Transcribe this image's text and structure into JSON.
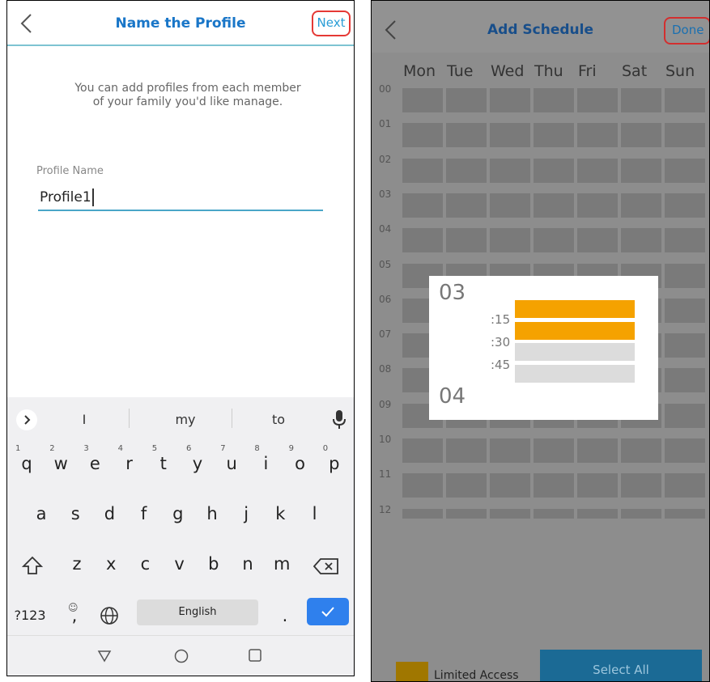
{
  "left": {
    "header": {
      "title": "Name the Profile",
      "next_label": "Next"
    },
    "description": "You can add profiles from each member of your family you'd like manage.",
    "field": {
      "label": "Profile Name",
      "value": "Profile1"
    },
    "keyboard": {
      "suggestions": [
        "I",
        "my",
        "to"
      ],
      "row1": [
        {
          "k": "q",
          "n": "1"
        },
        {
          "k": "w",
          "n": "2"
        },
        {
          "k": "e",
          "n": "3"
        },
        {
          "k": "r",
          "n": "4"
        },
        {
          "k": "t",
          "n": "5"
        },
        {
          "k": "y",
          "n": "6"
        },
        {
          "k": "u",
          "n": "7"
        },
        {
          "k": "i",
          "n": "8"
        },
        {
          "k": "o",
          "n": "9"
        },
        {
          "k": "p",
          "n": "0"
        }
      ],
      "row2": [
        "a",
        "s",
        "d",
        "f",
        "g",
        "h",
        "j",
        "k",
        "l"
      ],
      "row3": [
        "z",
        "x",
        "c",
        "v",
        "b",
        "n",
        "m"
      ],
      "symbols_label": "?123",
      "comma_label": ",",
      "space_label": "English",
      "period_label": "."
    }
  },
  "right": {
    "header": {
      "title": "Add Schedule",
      "done_label": "Done"
    },
    "days": [
      "Mon",
      "Tue",
      "Wed",
      "Thu",
      "Fri",
      "Sat",
      "Sun"
    ],
    "hours": [
      "00",
      "01",
      "02",
      "03",
      "04",
      "05",
      "06",
      "07",
      "08",
      "09",
      "10",
      "11",
      "12"
    ],
    "popup": {
      "start_hour": "03",
      "end_hour": "04",
      "marks": [
        ":15",
        ":30",
        ":45"
      ],
      "slots": [
        "limited",
        "limited",
        "none",
        "none"
      ]
    },
    "colors": {
      "limited": "#f5a200",
      "none": "#dcdcdc"
    },
    "legend_label": "Limited Access",
    "select_all_label": "Select All"
  }
}
